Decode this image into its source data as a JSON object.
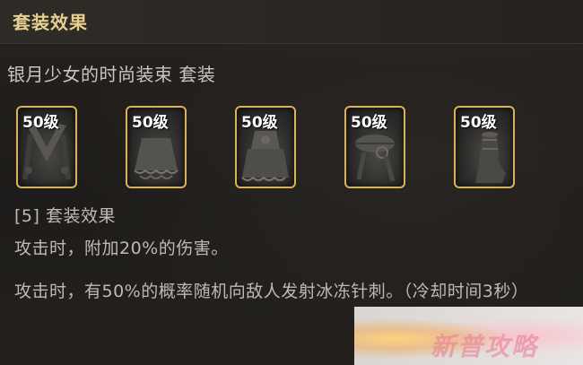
{
  "header": {
    "title": "套装效果"
  },
  "set": {
    "name": "银月少女的时尚装束 套装"
  },
  "items": [
    {
      "level": "50级",
      "icon": "armor-piece-icon"
    },
    {
      "level": "50级",
      "icon": "skirt-piece-icon"
    },
    {
      "level": "50级",
      "icon": "dress-piece-icon"
    },
    {
      "level": "50级",
      "icon": "bow-piece-icon"
    },
    {
      "level": "50级",
      "icon": "boot-piece-icon"
    }
  ],
  "effects": {
    "title": "[5] 套装效果",
    "line1": "攻击时，附加20%的伤害。",
    "line2": "攻击时，有50%的概率随机向敌人发射冰冻针刺。（冷却时间3秒）"
  },
  "watermark": {
    "text": "新普攻略"
  },
  "colors": {
    "title": "#e7cf8e",
    "slot_border": "#d9b25a",
    "text": "#bdbab4"
  }
}
